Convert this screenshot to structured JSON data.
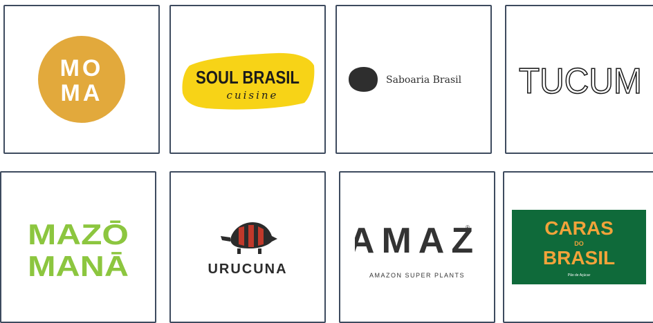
{
  "logos": [
    {
      "name": "MOMA",
      "line1": "MO",
      "line2": "MA",
      "color": "#e2a93c"
    },
    {
      "name": "SOUL BRASIL",
      "main": "SOUL BRASIL",
      "script": "cuisine",
      "color": "#f7d317"
    },
    {
      "name": "Saboaria Brasil",
      "text": "Saboaria Brasil"
    },
    {
      "name": "TUCUM",
      "text": "TUCUM"
    },
    {
      "name": "MAZO MANA",
      "line1": "MAZŌ",
      "line2": "MANĀ",
      "color": "#8cc63f"
    },
    {
      "name": "URUCUNA",
      "text": "URUCUNA"
    },
    {
      "name": "AMAZ",
      "main": "AMAZ",
      "reg": "®",
      "tagline": "AMAZON SUPER PLANTS"
    },
    {
      "name": "CARAS DO BRASIL",
      "line1": "CARAS",
      "small": "DO",
      "line2": "BRASIL",
      "footer": "Pão de Açúcar",
      "bg": "#0f6a3a",
      "fg": "#f2a33a"
    }
  ]
}
